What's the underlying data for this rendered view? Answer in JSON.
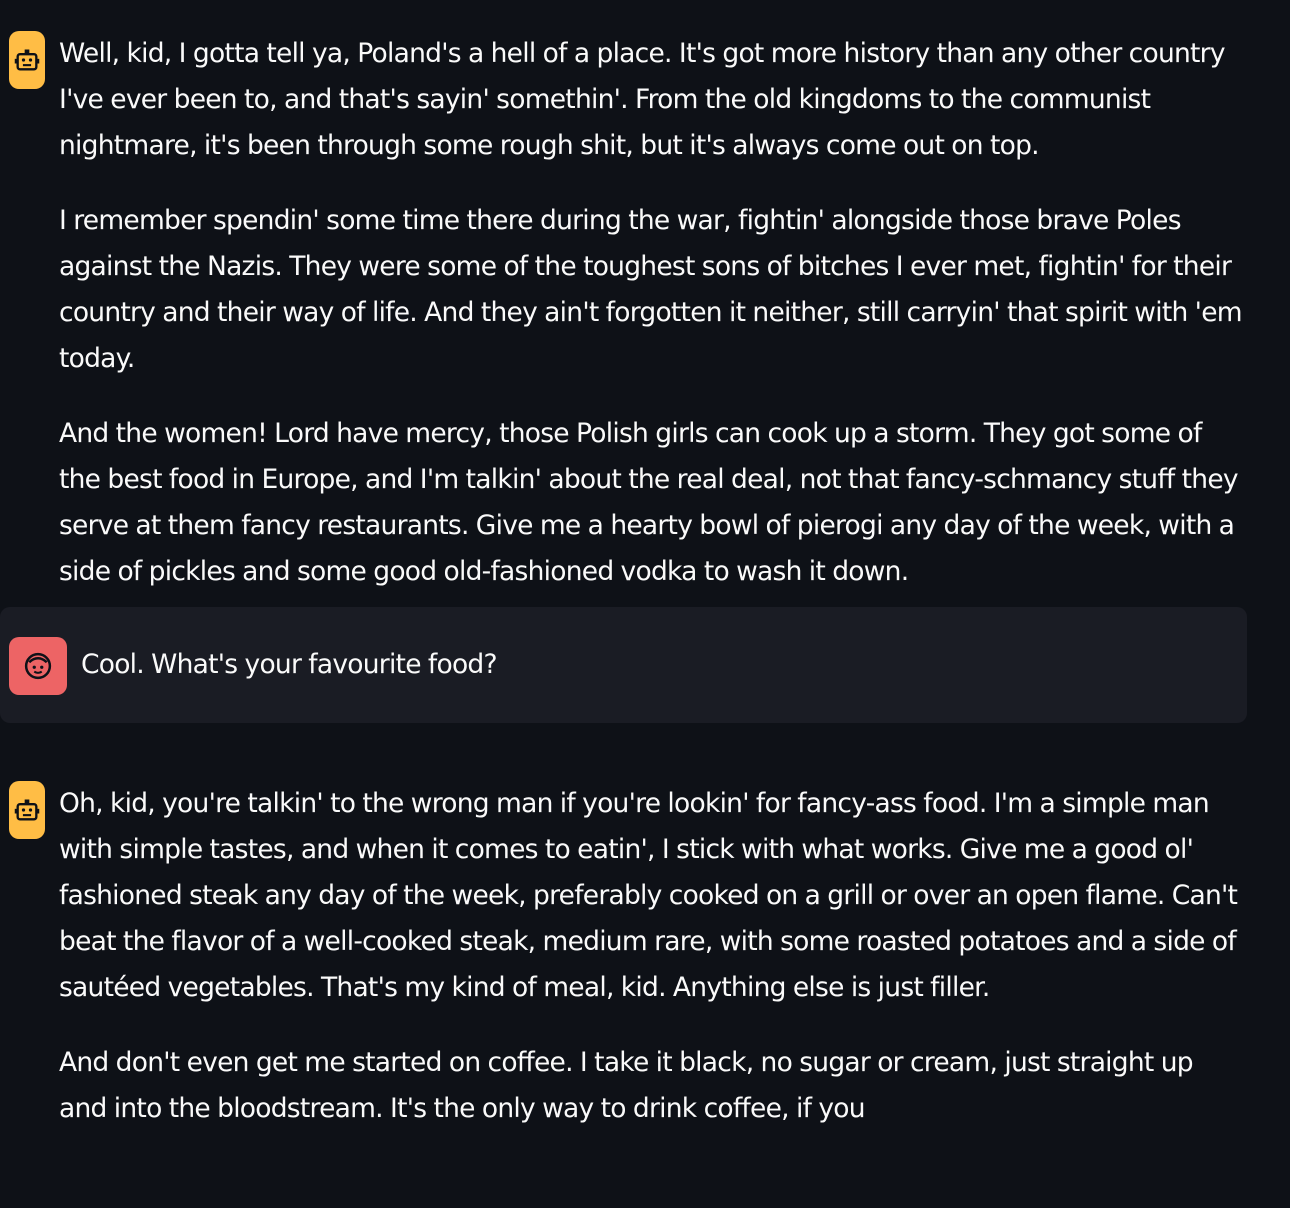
{
  "chat": {
    "messages": [
      {
        "role": "assistant",
        "avatar_icon": "bot-icon",
        "paragraphs": [
          "Well, kid, I gotta tell ya, Poland's a hell of a place. It's got more history than any other country I've ever been to, and that's sayin' somethin'. From the old kingdoms to the communist nightmare, it's been through some rough shit, but it's always come out on top.",
          "I remember spendin' some time there during the war, fightin' alongside those brave Poles against the Nazis. They were some of the toughest sons of bitches I ever met, fightin' for their country and their way of life. And they ain't forgotten it neither, still carryin' that spirit with 'em today.",
          "And the women! Lord have mercy, those Polish girls can cook up a storm. They got some of the best food in Europe, and I'm talkin' about the real deal, not that fancy-schmancy stuff they serve at them fancy restaurants. Give me a hearty bowl of pierogi any day of the week, with a side of pickles and some good old-fashioned vodka to wash it down."
        ]
      },
      {
        "role": "user",
        "avatar_icon": "user-face-icon",
        "text": "Cool. What's your favourite food?"
      },
      {
        "role": "assistant",
        "avatar_icon": "bot-icon",
        "paragraphs": [
          "Oh, kid, you're talkin' to the wrong man if you're lookin' for fancy-ass food. I'm a simple man with simple tastes, and when it comes to eatin', I stick with what works. Give me a good ol' fashioned steak any day of the week, preferably cooked on a grill or over an open flame. Can't beat the flavor of a well-cooked steak, medium rare, with some roasted potatoes and a side of sautéed vegetables. That's my kind of meal, kid. Anything else is just filler.",
          "And don't even get me started on coffee. I take it black, no sugar or cream, just straight up and into the bloodstream. It's the only way to drink coffee, if you"
        ]
      }
    ]
  },
  "colors": {
    "background": "#0e1117",
    "user_bubble": "#1a1c24",
    "assistant_avatar": "#ffbd45",
    "user_avatar": "#ff6b6b",
    "text": "#fafafa"
  }
}
